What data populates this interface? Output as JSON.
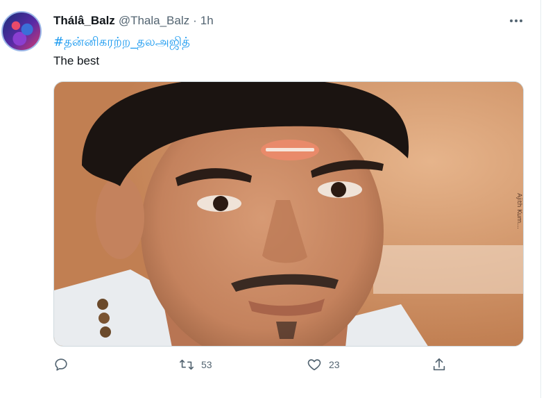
{
  "tweet": {
    "display_name": "Thálâ_Balz",
    "handle": "@Thala_Balz",
    "separator": "·",
    "time": "1h",
    "hashtag": "#தன்னிகரற்ற_தலஅஜித்",
    "text": "The best",
    "image_watermark": "Ajith Kum..."
  },
  "actions": {
    "reply_count": "",
    "retweet_count": "53",
    "like_count": "23"
  },
  "icons": [
    "more-icon",
    "reply-icon",
    "retweet-icon",
    "like-icon",
    "share-icon"
  ],
  "colors": {
    "link": "#1d9bf0",
    "muted": "#536471",
    "text": "#0f1419"
  }
}
